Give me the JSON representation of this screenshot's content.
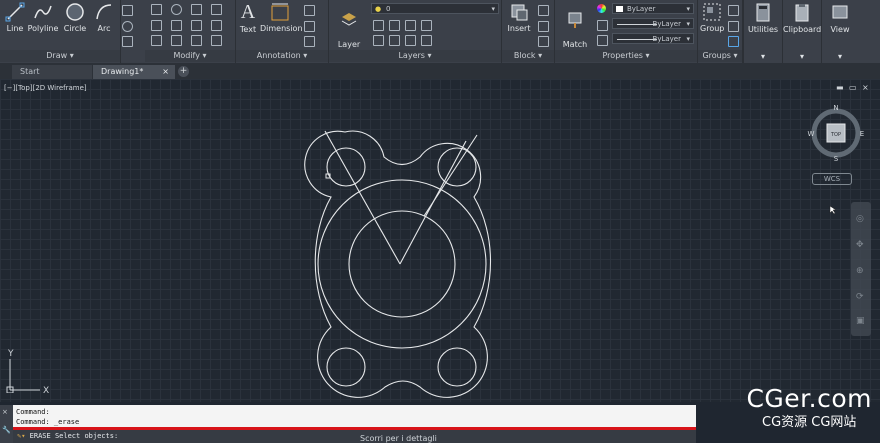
{
  "ribbon": {
    "draw": {
      "title": "Draw",
      "tools": [
        "Line",
        "Polyline",
        "Circle",
        "Arc"
      ]
    },
    "modify": {
      "title": "Modify"
    },
    "annotation": {
      "title": "Annotation",
      "tools": [
        "Text",
        "Dimension"
      ]
    },
    "layers": {
      "title": "Layers",
      "layer_properties": "Layer\nProperties",
      "current_layer": "0"
    },
    "block": {
      "title": "Block",
      "insert": "Insert"
    },
    "properties": {
      "title": "Properties",
      "match": "Match\nProperties",
      "color": "ByLayer",
      "linetype": "ByLayer",
      "lineweight": "ByLayer"
    },
    "groups": {
      "title": "Groups",
      "group": "Group"
    },
    "utilities": "Utilities",
    "clipboard": "Clipboard",
    "view": "View"
  },
  "tabs": [
    {
      "label": "Start"
    },
    {
      "label": "Drawing1*"
    }
  ],
  "viewport": {
    "label": "[−][Top][2D Wireframe]",
    "viewcube": {
      "top": "TOP",
      "north": "N",
      "south": "S",
      "east": "E",
      "west": "W"
    },
    "wcs": "WCS",
    "ucs_x": "X",
    "ucs_y": "Y"
  },
  "command": {
    "history": [
      "Command:",
      "Command: _erase"
    ],
    "prompt": "ERASE Select objects:"
  },
  "overlay": {
    "watermark_main": "CGer.com",
    "watermark_sub": "CG资源 CG网站",
    "subtitle": "Scorri per i dettagli"
  },
  "colors": {
    "ribbon_bg": "#3b4049",
    "canvas_bg": "#212831",
    "geometry": "#e6e8ea",
    "command_bar": "#d8141a"
  }
}
